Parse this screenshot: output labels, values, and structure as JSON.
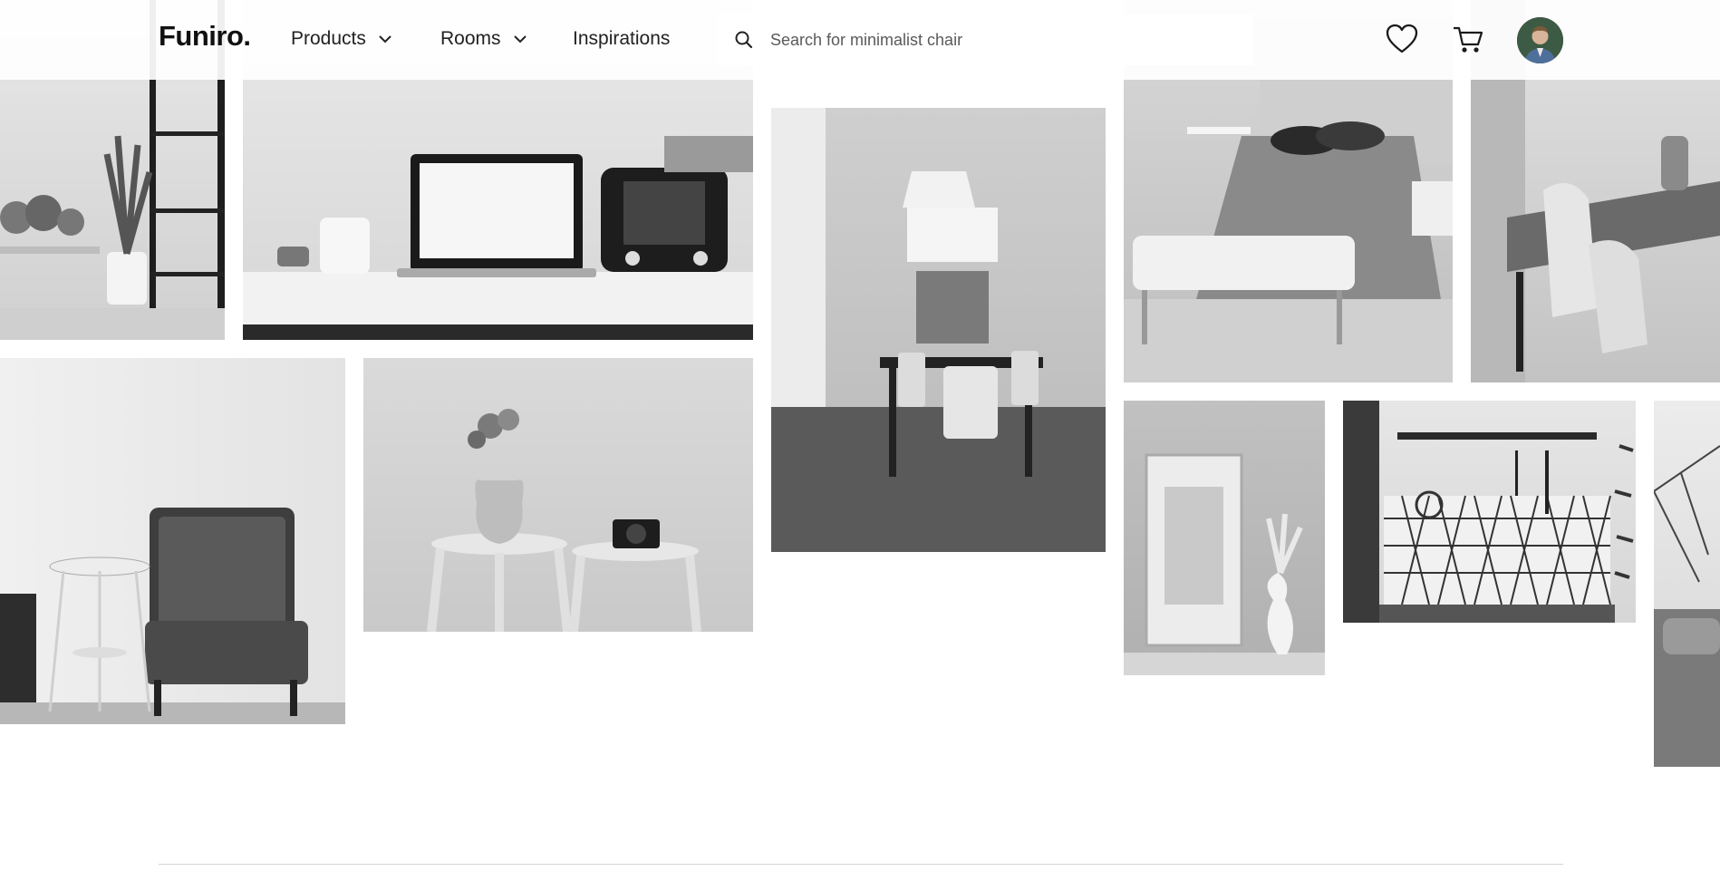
{
  "brand": {
    "logo": "Funiro."
  },
  "nav": {
    "items": [
      {
        "label": "Products",
        "has_dropdown": true
      },
      {
        "label": "Rooms",
        "has_dropdown": true
      },
      {
        "label": "Inspirations",
        "has_dropdown": false
      }
    ]
  },
  "search": {
    "placeholder": "Search for minimalist chair",
    "icon": "search-icon"
  },
  "actions": {
    "wishlist_icon": "heart-icon",
    "cart_icon": "cart-icon",
    "profile_icon": "avatar"
  },
  "gallery": {
    "style": "grayscale photo collage",
    "photos": [
      "living-room-shelf-with-plants",
      "desk-with-laptop-and-radio",
      "dining-room-with-pendant-lamp",
      "bedroom-with-bench",
      "dining-table-with-chairs",
      "armchair-with-side-table",
      "vase-and-camera-on-stools",
      "frame-and-vase-on-wall",
      "kitchen-shelf-with-tiles",
      "bed-with-metal-frame"
    ]
  },
  "colors": {
    "header_bg": "#ffffff",
    "text": "#1a1a1a",
    "divider": "#d4d4d4"
  }
}
